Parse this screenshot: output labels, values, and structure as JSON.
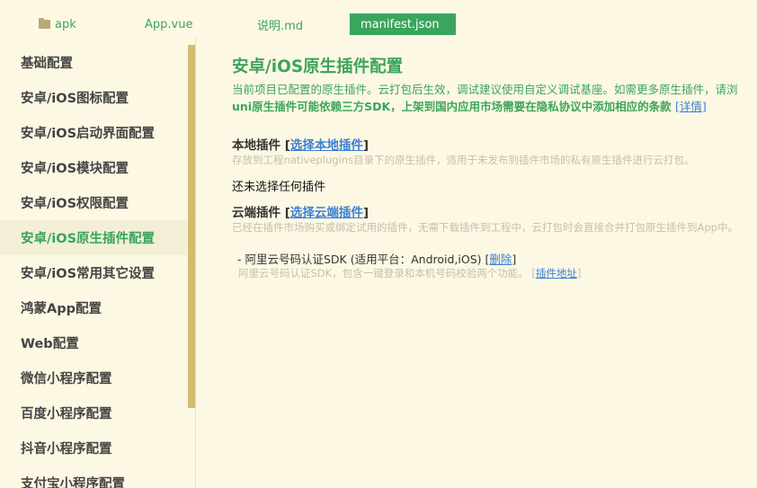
{
  "tabs": [
    {
      "label": "apk",
      "icon": "folder-icon"
    },
    {
      "label": "App.vue"
    },
    {
      "label": "说明.md"
    },
    {
      "label": "manifest.json",
      "active": true
    }
  ],
  "sidebar": {
    "items": [
      {
        "label": "基础配置"
      },
      {
        "label": "安卓/iOS图标配置"
      },
      {
        "label": "安卓/iOS启动界面配置"
      },
      {
        "label": "安卓/iOS模块配置"
      },
      {
        "label": "安卓/iOS权限配置"
      },
      {
        "label": "安卓/iOS原生插件配置",
        "active": true
      },
      {
        "label": "安卓/iOS常用其它设置"
      },
      {
        "label": "鸿蒙App配置"
      },
      {
        "label": "Web配置"
      },
      {
        "label": "微信小程序配置"
      },
      {
        "label": "百度小程序配置"
      },
      {
        "label": "抖音小程序配置"
      },
      {
        "label": "支付宝小程序配置"
      }
    ]
  },
  "main": {
    "title": "安卓/iOS原生插件配置",
    "desc1": "当前项目已配置的原生插件。云打包后生效，调试建议使用自定义调试基座。如需更多原生插件，请浏",
    "desc2": "uni原生插件可能依赖三方SDK，上架到国内应用市场需要在隐私协议中添加相应的条款",
    "desc2_link": "[详情]",
    "local": {
      "title": "本地插件",
      "bracket_open": "[",
      "link": "选择本地插件",
      "bracket_close": "]",
      "hint": "存放到工程nativeplugins目录下的原生插件，适用于未发布到插件市场的私有原生插件进行云打包。",
      "empty": "还未选择任何插件"
    },
    "cloud": {
      "title": "云端插件",
      "bracket_open": "[",
      "link": "选择云端插件",
      "bracket_close": "]",
      "hint": "已经在插件市场购买或绑定试用的插件，无需下载插件到工程中，云打包时会直接合并打包原生插件到App中。",
      "plugin": {
        "name": "- 阿里云号码认证SDK (适用平台：Android,iOS)",
        "delete_open": "[",
        "delete_link": "删除",
        "delete_close": "]",
        "desc": "阿里云号码认证SDK，包含一键登录和本机号码校验两个功能。",
        "addr_open": "[",
        "addr_link": "插件地址",
        "addr_close": "]"
      }
    }
  }
}
